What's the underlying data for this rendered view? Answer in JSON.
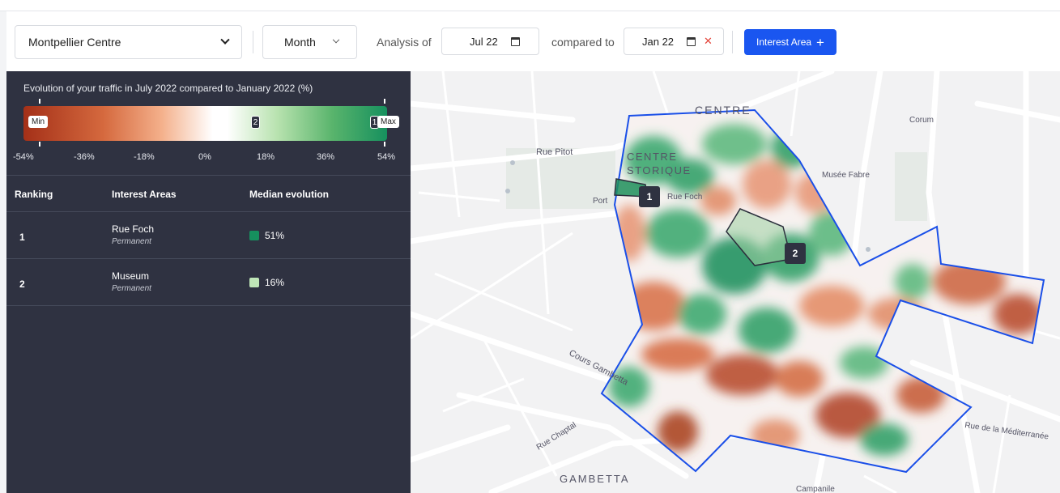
{
  "toolbar": {
    "location": "Montpellier Centre",
    "period": "Month",
    "analysis_label": "Analysis of",
    "date_from": "Jul 22",
    "compared_label": "compared to",
    "date_to": "Jan 22",
    "interest_button": "Interest Area",
    "plus": "+"
  },
  "legend": {
    "title": "Evolution of your traffic in July 2022 compared to January 2022 (%)",
    "min_label": "Min",
    "max_label": "Max",
    "marker_1": "1",
    "marker_2": "2",
    "scale": [
      "-54%",
      "-36%",
      "-18%",
      "0%",
      "18%",
      "36%",
      "54%"
    ],
    "colors": {
      "low": "#a43018",
      "mid": "#ffffff",
      "high": "#16905e"
    }
  },
  "table": {
    "headers": [
      "Ranking",
      "Interest Areas",
      "Median evolution"
    ],
    "rows": [
      {
        "rank": "1",
        "name": "Rue Foch",
        "type": "Permanent",
        "evolution": "51%",
        "color": "#16905e"
      },
      {
        "rank": "2",
        "name": "Museum",
        "type": "Permanent",
        "evolution": "16%",
        "color": "#bfe6b7"
      }
    ]
  },
  "map": {
    "labels": {
      "centre": "CENTRE",
      "centre_historique_1": "CENTRE",
      "centre_historique_2": "STORIQUE",
      "rue_pitot": "Rue Pitot",
      "corum": "Corum",
      "musee_fabre": "Musée Fabre",
      "rue_foch": "Rue Foch",
      "port": "Port",
      "cours_gambetta": "Cours Gambetta",
      "rue_chaptal": "Rue Chaptal",
      "gambetta": "GAMBETTA",
      "mediterranee": "Rue de la Méditerranée",
      "campanile": "Campanile"
    },
    "markers": [
      "1",
      "2"
    ]
  }
}
